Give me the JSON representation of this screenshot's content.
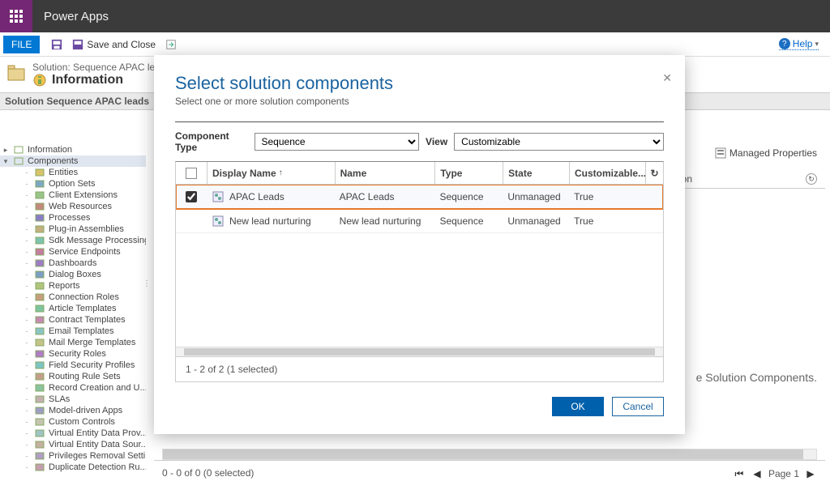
{
  "header": {
    "app_name": "Power Apps"
  },
  "ribbon": {
    "file": "FILE",
    "save_and_close": "Save and Close",
    "help": "Help"
  },
  "breadcrumb": {
    "solution_line": "Solution: Sequence APAC leads",
    "info_label": "Information"
  },
  "nav_strip": "Solution Sequence APAC leads",
  "tree": {
    "information": "Information",
    "components": "Components",
    "items": [
      "Entities",
      "Option Sets",
      "Client Extensions",
      "Web Resources",
      "Processes",
      "Plug-in Assemblies",
      "Sdk Message Processing...",
      "Service Endpoints",
      "Dashboards",
      "Dialog Boxes",
      "Reports",
      "Connection Roles",
      "Article Templates",
      "Contract Templates",
      "Email Templates",
      "Mail Merge Templates",
      "Security Roles",
      "Field Security Profiles",
      "Routing Rule Sets",
      "Record Creation and U...",
      "SLAs",
      "Model-driven Apps",
      "Custom Controls",
      "Virtual Entity Data Prov...",
      "Virtual Entity Data Sour...",
      "Privileges Removal Setting",
      "Duplicate Detection Ru..."
    ]
  },
  "under": {
    "managed_props": "Managed Properties",
    "col_ion": "ion",
    "message_tail": "e Solution Components.",
    "footer_count": "0 - 0 of 0 (0 selected)",
    "page_label": "Page 1"
  },
  "dialog": {
    "title": "Select solution components",
    "subtitle": "Select one or more solution components",
    "ct_label": "Component Type",
    "ct_value": "Sequence",
    "view_label": "View",
    "view_value": "Customizable",
    "cols": {
      "display_name": "Display Name",
      "name": "Name",
      "type": "Type",
      "state": "State",
      "customizable": "Customizable..."
    },
    "rows": [
      {
        "checked": true,
        "display_name": "APAC Leads",
        "name": "APAC Leads",
        "type": "Sequence",
        "state": "Unmanaged",
        "customizable": "True",
        "highlighted": true
      },
      {
        "checked": false,
        "display_name": "New lead nurturing",
        "name": "New lead nurturing",
        "type": "Sequence",
        "state": "Unmanaged",
        "customizable": "True",
        "highlighted": false
      }
    ],
    "footer_count": "1 - 2 of 2 (1 selected)",
    "ok": "OK",
    "cancel": "Cancel"
  }
}
